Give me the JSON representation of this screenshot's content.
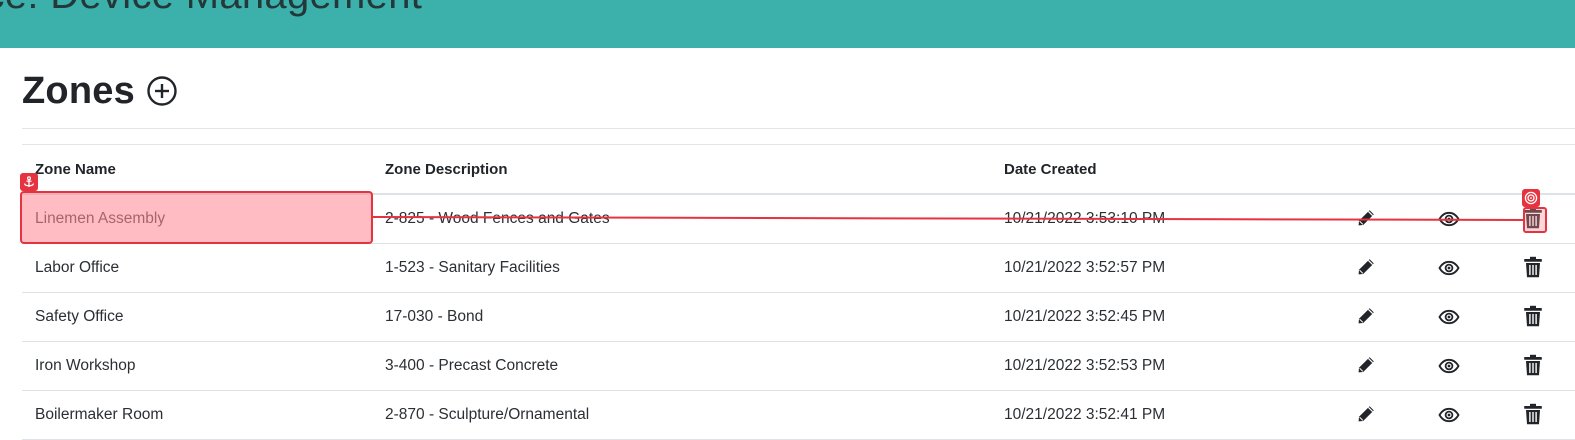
{
  "banner": {
    "title": "nce: Device Management"
  },
  "page": {
    "title": "Zones"
  },
  "table": {
    "headers": {
      "name": "Zone Name",
      "description": "Zone Description",
      "created": "Date Created"
    },
    "rows": [
      {
        "name": "Linemen Assembly",
        "description": "2-825 - Wood Fences and Gates",
        "created": "10/21/2022 3:53:10 PM"
      },
      {
        "name": "Labor Office",
        "description": "1-523 - Sanitary Facilities",
        "created": "10/21/2022 3:52:57 PM"
      },
      {
        "name": "Safety Office",
        "description": "17-030 - Bond",
        "created": "10/21/2022 3:52:45 PM"
      },
      {
        "name": "Iron Workshop",
        "description": "3-400 - Precast Concrete",
        "created": "10/21/2022 3:52:53 PM"
      },
      {
        "name": "Boilermaker Room",
        "description": "2-870 - Sculpture/Ornamental",
        "created": "10/21/2022 3:52:41 PM"
      }
    ]
  },
  "icons": {
    "add": "plus-circle-icon",
    "edit": "pencil-icon",
    "view": "eye-icon",
    "delete": "trash-icon",
    "anchor": "anchor-icon",
    "target": "target-icon"
  },
  "colors": {
    "banner": "#3cb1ab",
    "annotation": "#e5333f"
  }
}
